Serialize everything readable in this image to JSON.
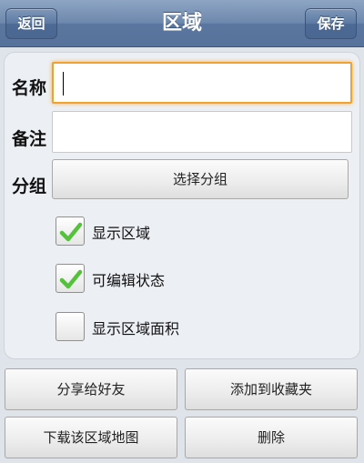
{
  "navbar": {
    "title": "区域",
    "back_label": "返回",
    "save_label": "保存"
  },
  "form": {
    "name_label": "名称",
    "name_value": "",
    "note_label": "备注",
    "note_value": "",
    "group_label": "分组",
    "group_button": "选择分组"
  },
  "options": [
    {
      "label": "显示区域",
      "checked": true
    },
    {
      "label": "可编辑状态",
      "checked": true
    },
    {
      "label": "显示区域面积",
      "checked": false
    }
  ],
  "actions": {
    "share": "分享给好友",
    "favorite": "添加到收藏夹",
    "download_map": "下载该区域地图",
    "delete": "删除"
  },
  "colors": {
    "check_green": "#54c23b",
    "focus_orange": "#f2a12e"
  }
}
